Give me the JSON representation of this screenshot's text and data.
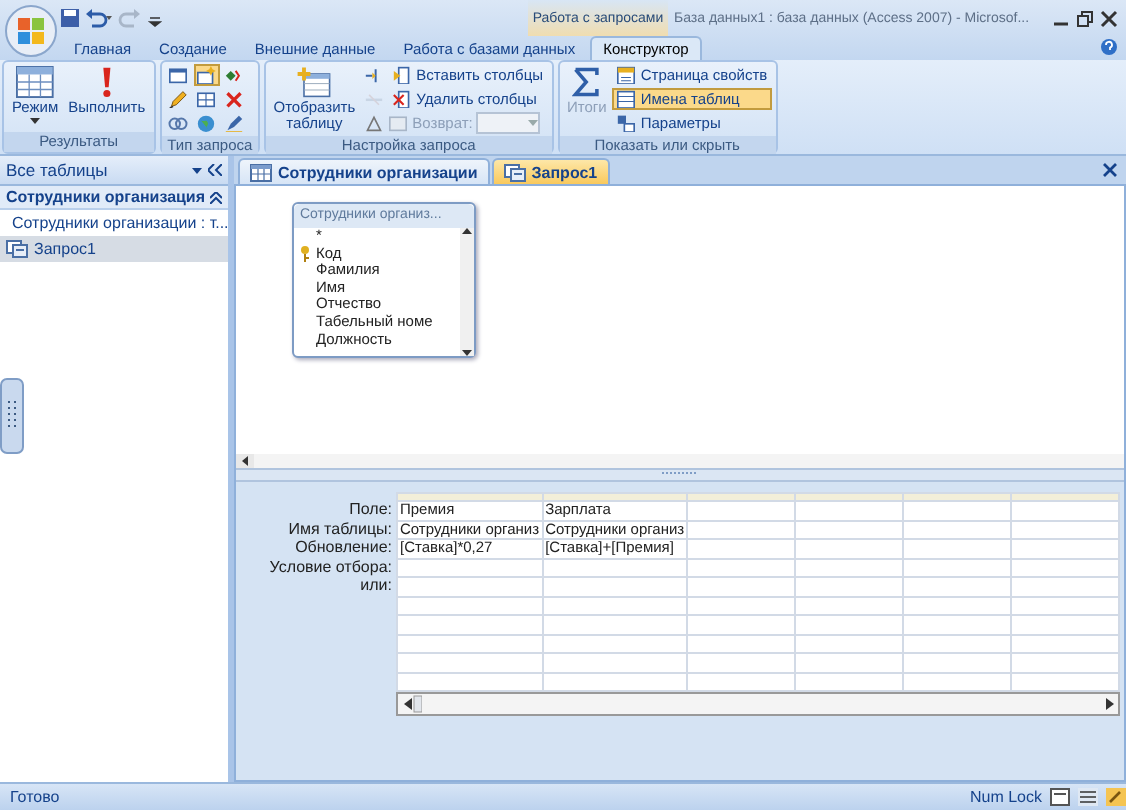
{
  "title_bar": {
    "context_tab": "Работа с запросами",
    "title": "База данных1 : база данных (Access 2007) - Microsof..."
  },
  "ribbon_tabs": [
    {
      "label": "Главная",
      "selected": false
    },
    {
      "label": "Создание",
      "selected": false
    },
    {
      "label": "Внешние данные",
      "selected": false
    },
    {
      "label": "Работа с базами данных",
      "selected": false
    },
    {
      "label": "Конструктор",
      "selected": true
    }
  ],
  "ribbon_groups": [
    {
      "caption": "Результаты",
      "items": [
        {
          "kind": "large",
          "label": "Режим",
          "dropdown": true,
          "disabled": false
        },
        {
          "kind": "large",
          "label": "Выполнить",
          "dropdown": false,
          "disabled": false
        }
      ]
    },
    {
      "caption": "Тип запроса",
      "items": [
        {
          "kind": "icon",
          "disabled": false,
          "selected": false
        },
        {
          "kind": "icon",
          "disabled": false,
          "selected": false
        },
        {
          "kind": "icon",
          "disabled": false,
          "selected": false
        },
        {
          "kind": "icon",
          "disabled": false,
          "selected": true
        },
        {
          "kind": "icon",
          "disabled": false,
          "selected": false
        },
        {
          "kind": "icon",
          "disabled": false,
          "selected": false
        },
        {
          "kind": "icon",
          "disabled": false,
          "selected": false
        },
        {
          "kind": "icon",
          "disabled": false,
          "selected": false
        },
        {
          "kind": "icon",
          "disabled": false,
          "selected": false
        }
      ]
    },
    {
      "caption": "Настройка запроса",
      "items": [
        {
          "kind": "large",
          "label": "Отобразить таблицу",
          "dropdown": false,
          "disabled": false
        },
        {
          "kind": "icon",
          "disabled": false,
          "selected": false
        },
        {
          "kind": "icon",
          "disabled": true,
          "selected": false
        },
        {
          "kind": "icon",
          "disabled": false,
          "selected": false
        },
        {
          "kind": "small",
          "label": "Вставить столбцы",
          "disabled": false,
          "selected": false
        },
        {
          "kind": "small",
          "label": "Удалить столбцы",
          "disabled": false,
          "selected": false
        },
        {
          "kind": "combo",
          "label": "Возврат:",
          "disabled": true
        }
      ]
    },
    {
      "caption": "Показать или скрыть",
      "items": [
        {
          "kind": "large",
          "label": "Итоги",
          "dropdown": false,
          "disabled": true
        },
        {
          "kind": "small",
          "label": "Страница свойств",
          "disabled": false,
          "selected": false
        },
        {
          "kind": "small",
          "label": "Имена таблиц",
          "disabled": false,
          "selected": true
        },
        {
          "kind": "small",
          "label": "Параметры",
          "disabled": false,
          "selected": false
        }
      ]
    }
  ],
  "nav_pane": {
    "header": "Все таблицы",
    "groups": [
      {
        "label": "Сотрудники организация",
        "expanded": true,
        "items": [
          {
            "kind": "table",
            "label": "Сотрудники организации : т...",
            "selected": false
          },
          {
            "kind": "query",
            "label": "Запрос1",
            "selected": true
          }
        ]
      }
    ]
  },
  "document_tabs": [
    {
      "kind": "table",
      "label": "Сотрудники организации",
      "selected": false
    },
    {
      "kind": "query",
      "label": "Запрос1",
      "selected": true
    }
  ],
  "field_list": {
    "title": "Сотрудники организ...",
    "fields": [
      {
        "name": "*",
        "key": false
      },
      {
        "name": "Код",
        "key": true
      },
      {
        "name": "Фамилия",
        "key": false
      },
      {
        "name": "Имя",
        "key": false
      },
      {
        "name": "Отчество",
        "key": false
      },
      {
        "name": "Табельный номе",
        "key": false
      },
      {
        "name": "Должность",
        "key": false
      }
    ]
  },
  "design_grid": {
    "row_labels": [
      "Поле:",
      "Имя таблицы:",
      "Обновление:",
      "Условие отбора:",
      "или:"
    ],
    "columns": [
      {
        "field": "Премия",
        "table": "Сотрудники организ",
        "update": "[Ставка]*0,27"
      },
      {
        "field": "Зарплата",
        "table": "Сотрудники организ",
        "update": "[Ставка]+[Премия]"
      }
    ]
  },
  "status_bar": {
    "left": "Готово",
    "num_lock": "Num Lock"
  }
}
